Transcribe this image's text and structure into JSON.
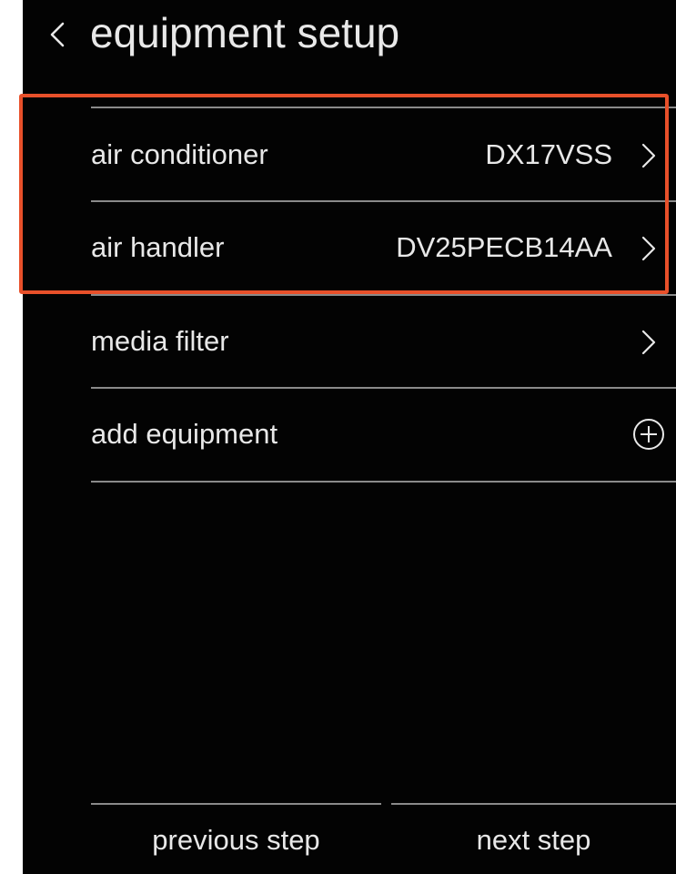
{
  "header": {
    "title": "equipment setup"
  },
  "equipment_list": {
    "items": [
      {
        "label": "air conditioner",
        "value": "DX17VSS",
        "icon": "chevron-right-icon"
      },
      {
        "label": "air handler",
        "value": "DV25PECB14AA",
        "icon": "chevron-right-icon"
      },
      {
        "label": "media filter",
        "value": "",
        "icon": "chevron-right-icon"
      },
      {
        "label": "add equipment",
        "value": "",
        "icon": "plus-circle-icon"
      }
    ]
  },
  "footer": {
    "previous_label": "previous step",
    "next_label": "next step"
  },
  "colors": {
    "background": "#030303",
    "text": "#e8e8e8",
    "divider": "#8a8a8a",
    "highlight": "#e8502a"
  }
}
